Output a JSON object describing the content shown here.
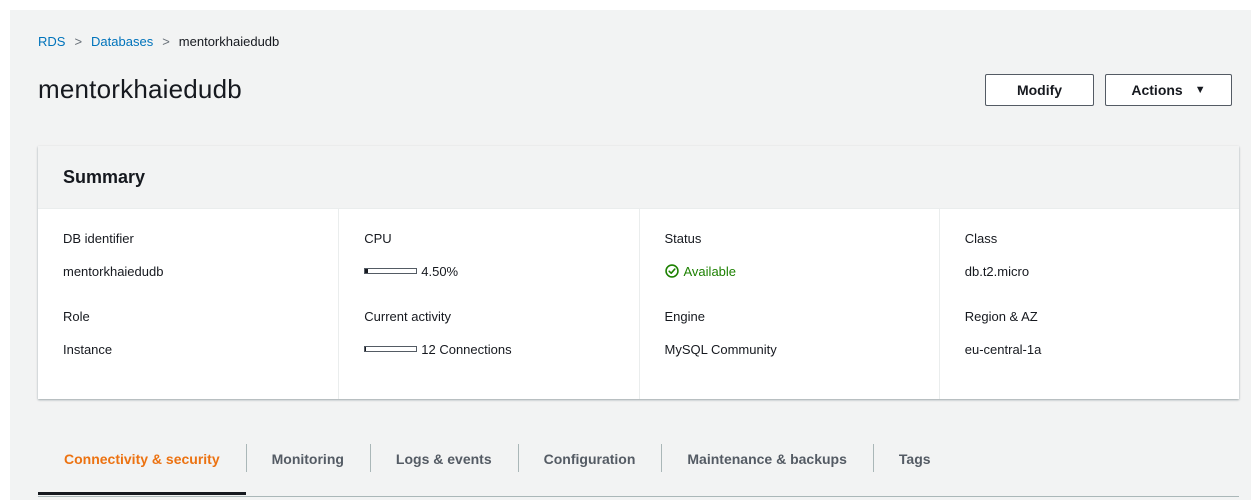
{
  "breadcrumb": {
    "items": [
      "RDS",
      "Databases",
      "mentorkhaiedudb"
    ],
    "separator": ">"
  },
  "page": {
    "title": "mentorkhaiedudb"
  },
  "buttons": {
    "modify": "Modify",
    "actions": "Actions",
    "actions_caret": "▼"
  },
  "summary": {
    "title": "Summary",
    "db_identifier": {
      "label": "DB identifier",
      "value": "mentorkhaiedudb"
    },
    "role": {
      "label": "Role",
      "value": "Instance"
    },
    "cpu": {
      "label": "CPU",
      "value": "4.50%",
      "fraction": 0.045
    },
    "current_activity": {
      "label": "Current activity",
      "value": "12 Connections",
      "fraction": 0.02
    },
    "status": {
      "label": "Status",
      "value": "Available",
      "icon": "check-circle-icon",
      "color": "#1d8102"
    },
    "engine": {
      "label": "Engine",
      "value": "MySQL Community"
    },
    "class": {
      "label": "Class",
      "value": "db.t2.micro"
    },
    "region": {
      "label": "Region & AZ",
      "value": "eu-central-1a"
    }
  },
  "tabs": [
    {
      "label": "Connectivity & security",
      "active": true
    },
    {
      "label": "Monitoring",
      "active": false
    },
    {
      "label": "Logs & events",
      "active": false
    },
    {
      "label": "Configuration",
      "active": false
    },
    {
      "label": "Maintenance & backups",
      "active": false
    },
    {
      "label": "Tags",
      "active": false
    }
  ],
  "colors": {
    "link": "#0073bb",
    "active_tab": "#ec7211",
    "success": "#1d8102"
  }
}
